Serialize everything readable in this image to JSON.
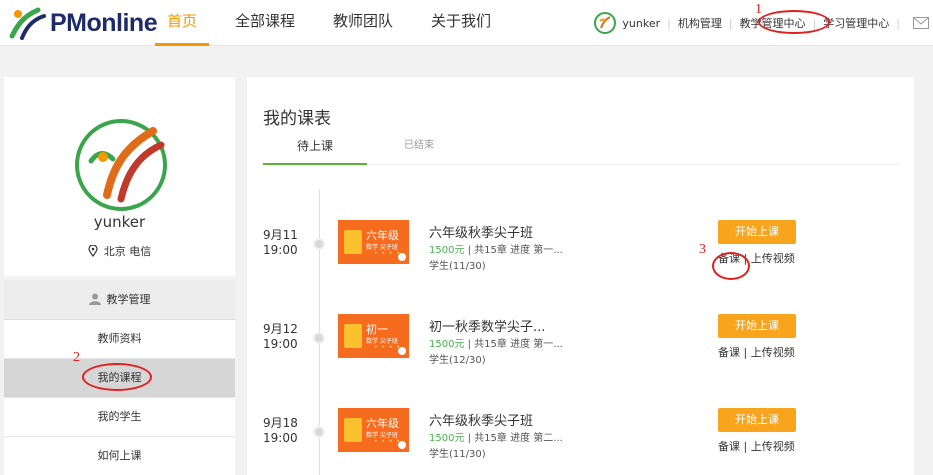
{
  "header": {
    "logo_text": "PMonline",
    "nav": [
      "首页",
      "全部课程",
      "教师团队",
      "关于我们"
    ],
    "user": {
      "name": "yunker",
      "links": [
        "机构管理",
        "教学管理中心",
        "学习管理中心"
      ]
    }
  },
  "annotations": [
    "1",
    "2",
    "3"
  ],
  "profile": {
    "name": "yunker",
    "location": "北京 电信"
  },
  "menu": {
    "header": "教学管理",
    "items": [
      "教师资料",
      "我的课程",
      "我的学生",
      "如何上课"
    ]
  },
  "main": {
    "title": "我的课表",
    "tabs": [
      "待上课",
      "已结束"
    ],
    "courses": [
      {
        "date": "9月11",
        "time": "19:00",
        "thumb_grade": "六年级",
        "thumb_sub": "数学 尖子班",
        "thumb_dots": "• • • •",
        "name": "六年级秋季尖子班",
        "price": "1500元",
        "meta_rest": " | 共15章 进度 第一...",
        "students": "学生(11/30)",
        "start_label": "开始上课",
        "prep_label": "备课",
        "upload_label": "上传视频"
      },
      {
        "date": "9月12",
        "time": "19:00",
        "thumb_grade": "初一",
        "thumb_sub": "数学 尖子班",
        "thumb_dots": "• • • •",
        "name": "初一秋季数学尖子...",
        "price": "1500元",
        "meta_rest": " | 共15章 进度 第一...",
        "students": "学生(12/30)",
        "start_label": "开始上课",
        "prep_label": "备课",
        "upload_label": "上传视频"
      },
      {
        "date": "9月18",
        "time": "19:00",
        "thumb_grade": "六年级",
        "thumb_sub": "数学 尖子班",
        "thumb_dots": "• • • •",
        "name": "六年级秋季尖子班",
        "price": "1500元",
        "meta_rest": " | 共15章 进度 第二...",
        "students": "学生(11/30)",
        "start_label": "开始上课",
        "prep_label": "备课",
        "upload_label": "上传视频"
      }
    ]
  },
  "colors": {
    "accent": "#f39800",
    "button": "#f8a51d",
    "tab_underline": "#5cb531",
    "price": "#4caf50",
    "annotation": "#e02020",
    "thumb": "#f66b1e"
  }
}
